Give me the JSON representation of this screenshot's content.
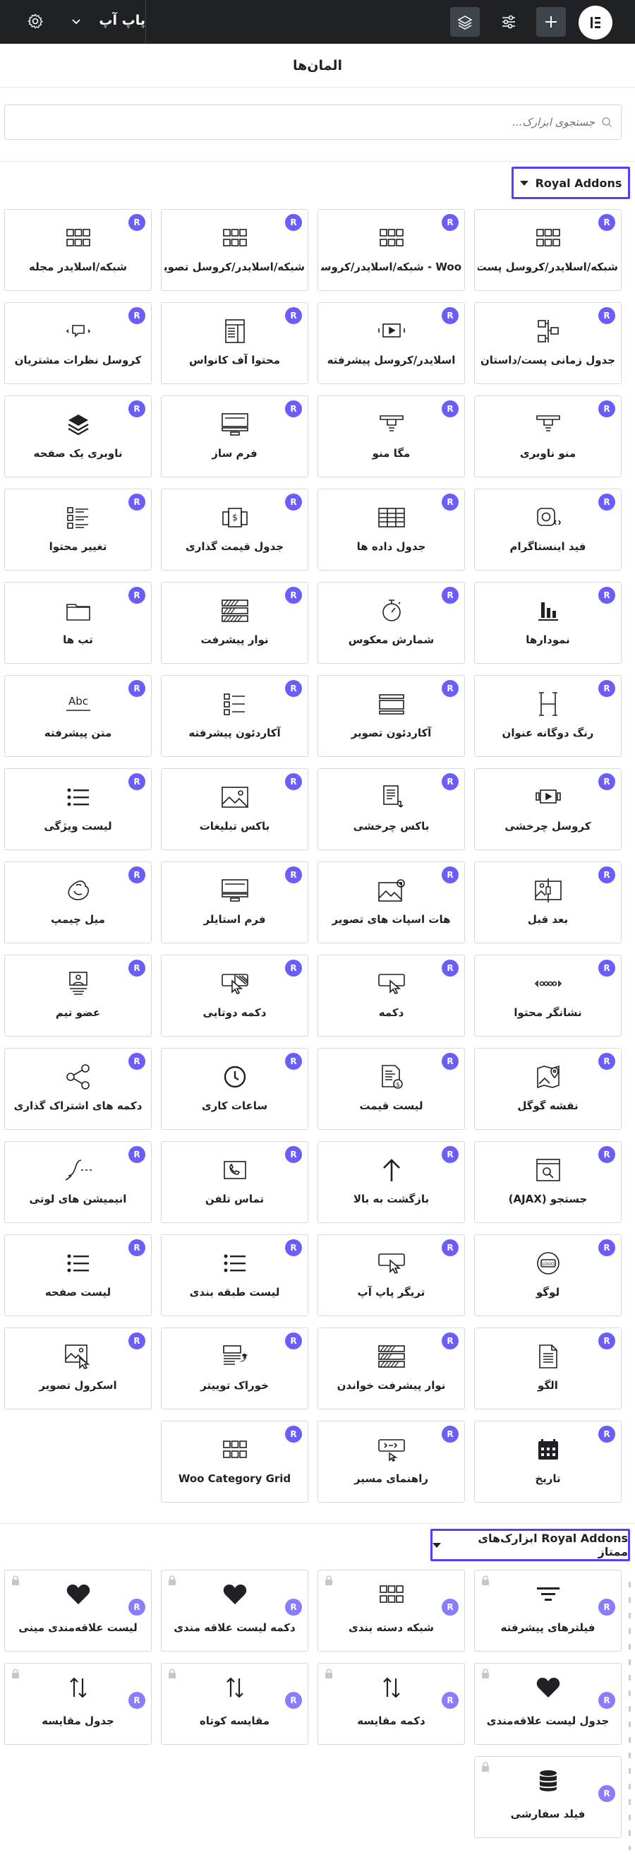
{
  "topbar": {
    "title": "پاپ آپ",
    "logo": "elementor-logo",
    "buttons": [
      "plus-icon",
      "sliders-icon",
      "layers-icon"
    ],
    "settings": "gear-icon"
  },
  "panel": {
    "title": "المان‌ها"
  },
  "search": {
    "placeholder": "جستجوی ابزارک..."
  },
  "badge_text": "R",
  "accent_color": "#5a3ef5",
  "categories": [
    {
      "title": "Royal Addons",
      "widgets": [
        {
          "label": "شبکه/اسلایدر/کروسل پست",
          "icon": "grid-icon"
        },
        {
          "label": "Woo - شبکه/اسلایدر/کروسل",
          "icon": "grid-icon"
        },
        {
          "label": "شبکه/اسلایدر/کروسل تصویر",
          "icon": "grid-icon"
        },
        {
          "label": "شبکه/اسلایدر مجله",
          "icon": "grid-icon"
        },
        {
          "label": "جدول زمانی پست/داستان",
          "icon": "timeline-icon"
        },
        {
          "label": "اسلایدر/کروسل پیشرفته",
          "icon": "slider-icon"
        },
        {
          "label": "محتوا آف کانواس",
          "icon": "offcanvas-icon"
        },
        {
          "label": "کروسل نظرات مشتریان",
          "icon": "testimonial-icon"
        },
        {
          "label": "منو ناوبری",
          "icon": "nav-menu-icon"
        },
        {
          "label": "مگا منو",
          "icon": "nav-menu-icon"
        },
        {
          "label": "فرم ساز",
          "icon": "form-icon"
        },
        {
          "label": "ناوبری یک صفحه",
          "icon": "layers-icon"
        },
        {
          "label": "فید اینستاگرام",
          "icon": "instagram-icon"
        },
        {
          "label": "جدول داده ها",
          "icon": "table-icon"
        },
        {
          "label": "جدول قیمت گذاری",
          "icon": "price-table-icon"
        },
        {
          "label": "تغییر محتوا",
          "icon": "content-toggle-icon"
        },
        {
          "label": "نمودارها",
          "icon": "chart-icon"
        },
        {
          "label": "شمارش معکوس",
          "icon": "countdown-icon"
        },
        {
          "label": "نوار پیشرفت",
          "icon": "progress-bar-icon"
        },
        {
          "label": "تب ها",
          "icon": "tabs-icon"
        },
        {
          "label": "رنگ دوگانه عنوان",
          "icon": "heading-icon"
        },
        {
          "label": "آکاردئون تصویر",
          "icon": "image-accordion-icon"
        },
        {
          "label": "آکاردئون پیشرفته",
          "icon": "accordion-icon"
        },
        {
          "label": "متن پیشرفته",
          "icon": "text-icon"
        },
        {
          "label": "کروسل چرخشی",
          "icon": "carousel-icon"
        },
        {
          "label": "باکس چرخشی",
          "icon": "flip-box-icon"
        },
        {
          "label": "باکس تبلیغات",
          "icon": "image-icon"
        },
        {
          "label": "لیست ویژگی",
          "icon": "list-icon"
        },
        {
          "label": "بعد قبل",
          "icon": "before-after-icon"
        },
        {
          "label": "هات اسپات های تصویر",
          "icon": "hotspot-icon"
        },
        {
          "label": "فرم استایلر",
          "icon": "form-icon"
        },
        {
          "label": "میل چیمپ",
          "icon": "mailchimp-icon"
        },
        {
          "label": "نشانگر محتوا",
          "icon": "dots-icon"
        },
        {
          "label": "دکمه",
          "icon": "button-icon"
        },
        {
          "label": "دکمه دوتایی",
          "icon": "dual-button-icon"
        },
        {
          "label": "عضو تیم",
          "icon": "team-member-icon"
        },
        {
          "label": "نقشه گوگل",
          "icon": "map-icon"
        },
        {
          "label": "لیست قیمت",
          "icon": "price-list-icon"
        },
        {
          "label": "ساعات کاری",
          "icon": "clock-icon"
        },
        {
          "label": "دکمه های اشتراک گذاری",
          "icon": "share-icon"
        },
        {
          "label": "جستجو (AJAX)",
          "icon": "search-box-icon"
        },
        {
          "label": "بازگشت به بالا",
          "icon": "arrow-up-icon"
        },
        {
          "label": "تماس تلفن",
          "icon": "phone-icon"
        },
        {
          "label": "انیمیشن های لوتی",
          "icon": "lottie-icon"
        },
        {
          "label": "لوگو",
          "icon": "logo-icon"
        },
        {
          "label": "تریگر پاپ آپ",
          "icon": "button-icon"
        },
        {
          "label": "لیست طبقه بندی",
          "icon": "list-icon"
        },
        {
          "label": "لیست صفحه",
          "icon": "list-icon"
        },
        {
          "label": "الگو",
          "icon": "template-icon"
        },
        {
          "label": "نوار پیشرفت خواندن",
          "icon": "progress-bar-icon"
        },
        {
          "label": "خوراک توییتر",
          "icon": "twitter-feed-icon"
        },
        {
          "label": "اسکرول تصویر",
          "icon": "image-scroll-icon"
        },
        {
          "label": "تاریخ",
          "icon": "calendar-icon"
        },
        {
          "label": "راهنمای مسیر",
          "icon": "breadcrumb-icon"
        },
        {
          "label": "Woo Category Grid",
          "icon": "grid-icon"
        }
      ]
    },
    {
      "title": "Royal Addons ابزارک‌های ممتاز",
      "widgets": [
        {
          "label": "فیلترهای پیشرفته",
          "icon": "filter-icon"
        },
        {
          "label": "شبکه دسته بندی",
          "icon": "grid-icon"
        },
        {
          "label": "دکمه لیست علاقه مندی",
          "icon": "heart-icon"
        },
        {
          "label": "لیست علاقه‌مندی مینی",
          "icon": "heart-icon"
        },
        {
          "label": "جدول لیست علاقه‌مندی",
          "icon": "heart-icon"
        },
        {
          "label": "دکمه مقایسه",
          "icon": "compare-icon"
        },
        {
          "label": "مقایسه کوتاه",
          "icon": "compare-icon"
        },
        {
          "label": "جدول مقایسه",
          "icon": "compare-icon"
        },
        {
          "label": "فیلد سفارشی",
          "icon": "database-icon"
        }
      ]
    }
  ]
}
